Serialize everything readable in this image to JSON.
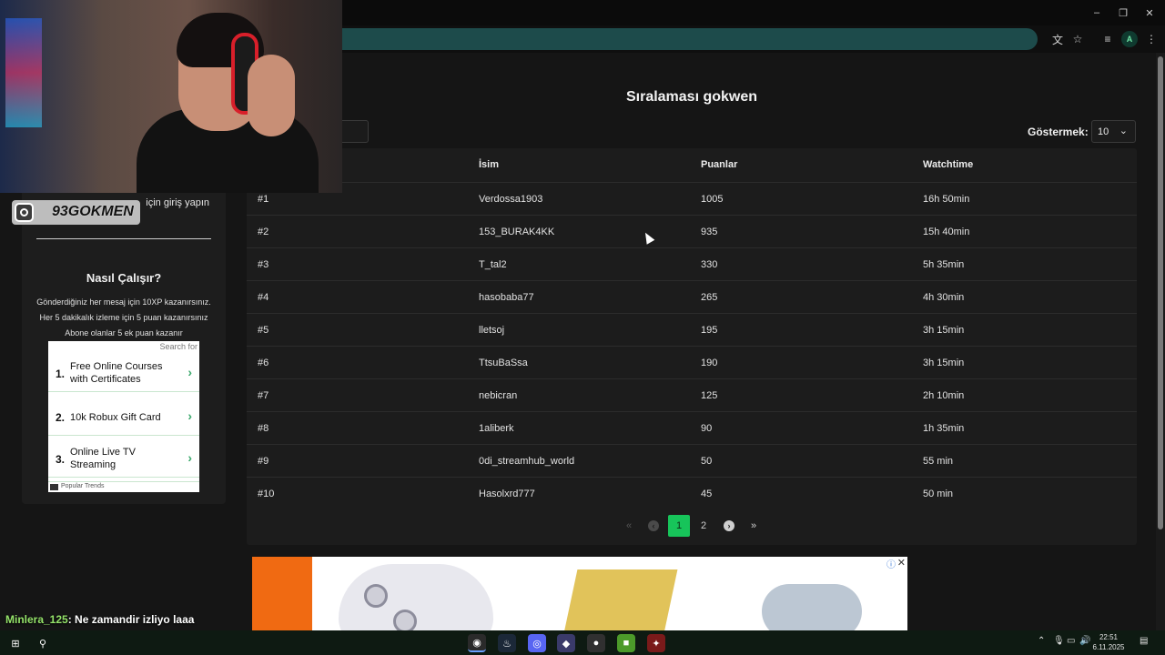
{
  "browser": {
    "window_controls": [
      "–",
      "❐",
      "✕"
    ],
    "profile_initial": "A"
  },
  "page": {
    "title": "Sıralaması gokwen",
    "show_label": "Göstermek:",
    "show_value": "10"
  },
  "sidebar": {
    "login_text": "için giriş yapın",
    "how_title": "Nasıl Çalışır?",
    "how_lines": [
      "Gönderdiğiniz her mesaj için 10XP kazanırsınız.",
      "Her 5 dakikalık izleme için 5 puan kazanırsınız",
      "Abone olanlar 5 ek puan kazanır"
    ]
  },
  "side_ad": {
    "search_label": "Search for",
    "items": [
      {
        "num": "1.",
        "text": "Free Online Courses with Certificates"
      },
      {
        "num": "2.",
        "text": "10k Robux Gift Card"
      },
      {
        "num": "3.",
        "text": "Online Live TV Streaming"
      }
    ],
    "footer": "Popular Trends"
  },
  "table": {
    "headers": [
      "İsim",
      "Puanlar",
      "Watchtime"
    ],
    "rows": [
      {
        "rank": "#1",
        "name": "Verdossa1903",
        "points": "1005",
        "watchtime": "16h 50min"
      },
      {
        "rank": "#2",
        "name": "153_BURAK4KK",
        "points": "935",
        "watchtime": "15h 40min"
      },
      {
        "rank": "#3",
        "name": "T_tal2",
        "points": "330",
        "watchtime": "5h 35min"
      },
      {
        "rank": "#4",
        "name": "hasobaba77",
        "points": "265",
        "watchtime": "4h 30min"
      },
      {
        "rank": "#5",
        "name": "lletsoj",
        "points": "195",
        "watchtime": "3h 15min"
      },
      {
        "rank": "#6",
        "name": "TtsuBaSsa",
        "points": "190",
        "watchtime": "3h 15min"
      },
      {
        "rank": "#7",
        "name": "nebicran",
        "points": "125",
        "watchtime": "2h 10min"
      },
      {
        "rank": "#8",
        "name": "1aliberk",
        "points": "90",
        "watchtime": "1h 35min"
      },
      {
        "rank": "#9",
        "name": "0di_streamhub_world",
        "points": "50",
        "watchtime": "55 min"
      },
      {
        "rank": "#10",
        "name": "Hasolxrd777",
        "points": "45",
        "watchtime": "50 min"
      }
    ]
  },
  "pagination": {
    "first": "«",
    "prev": "‹",
    "pages": [
      "1",
      "2"
    ],
    "next": "›",
    "last": "»"
  },
  "overlay": {
    "instagram_handle": "93GOKMEN",
    "chat_user": "Minlera_125",
    "chat_message": ": Ne zamandir izliyo laaa"
  },
  "taskbar": {
    "time": "22:51",
    "date": "6.11.2025"
  },
  "colors": {
    "accent": "#17c45a",
    "background": "#151515",
    "panel": "#1c1c1c"
  }
}
